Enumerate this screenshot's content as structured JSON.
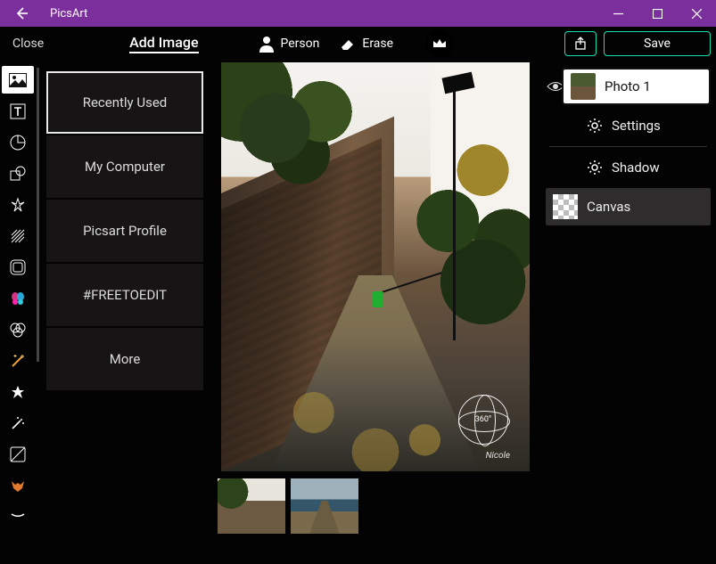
{
  "titlebar": {
    "app": "PicsArt"
  },
  "topbar": {
    "close": "Close",
    "add_image": "Add Image",
    "person": "Person",
    "erase": "Erase",
    "save": "Save"
  },
  "menu": {
    "items": [
      "Recently Used",
      "My Computer",
      "Picsart Profile",
      "#FREETOEDIT",
      "More"
    ]
  },
  "canvas": {
    "badge": "360°",
    "signature": "Nicole"
  },
  "rightpanel": {
    "photo1": "Photo 1",
    "settings": "Settings",
    "shadow": "Shadow",
    "canvas": "Canvas"
  }
}
